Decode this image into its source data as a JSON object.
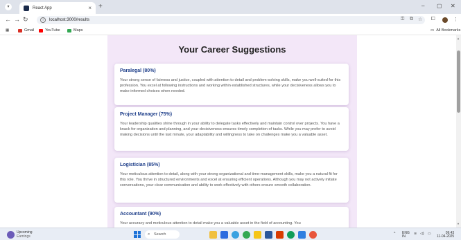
{
  "browser": {
    "tab_title": "React App",
    "tab_close": "×",
    "new_tab": "+",
    "url": "localhost:3000/results",
    "bookmarks": [
      {
        "label": "Gmail",
        "color": "#d93025"
      },
      {
        "label": "YouTube",
        "color": "#ff0000"
      },
      {
        "label": "Maps",
        "color": "#34a853"
      }
    ],
    "all_bookmarks": "All Bookmarks"
  },
  "page": {
    "heading": "Your Career Suggestions",
    "cards": [
      {
        "title": "Paralegal (80%)",
        "text": "Your strong sense of fairness and justice, coupled with attention to detail and problem-solving skills, make you well-suited for this profession. You excel at following instructions and working within established structures, while your decisiveness allows you to make informed choices when needed."
      },
      {
        "title": "Project Manager (75%)",
        "text": "Your leadership qualities shine through in your ability to delegate tasks effectively and maintain control over projects. You have a knack for organization and planning, and your decisiveness ensures timely completion of tasks. While you may prefer to avoid making decisions until the last minute, your adaptability and willingness to take on challenges make you a valuable asset."
      },
      {
        "title": "Logistician (85%)",
        "text": "Your meticulous attention to detail, along with your strong organizational and time-management skills, make you a natural fit for this role. You thrive in structured environments and excel at ensuring efficient operations. Although you may not actively initiate conversations, your clear communication and ability to work effectively with others ensure smooth collaboration."
      },
      {
        "title": "Accountant (90%)",
        "text": "Your accuracy and meticulous attention to detail make you a valuable asset in the field of accounting. You"
      }
    ]
  },
  "taskbar": {
    "weather_label": "Upcoming",
    "weather_sub": "Earnings",
    "search_placeholder": "Search",
    "lang": "ENG",
    "lang_region": "IN",
    "time": "09:43",
    "date": "11-04-2025"
  }
}
